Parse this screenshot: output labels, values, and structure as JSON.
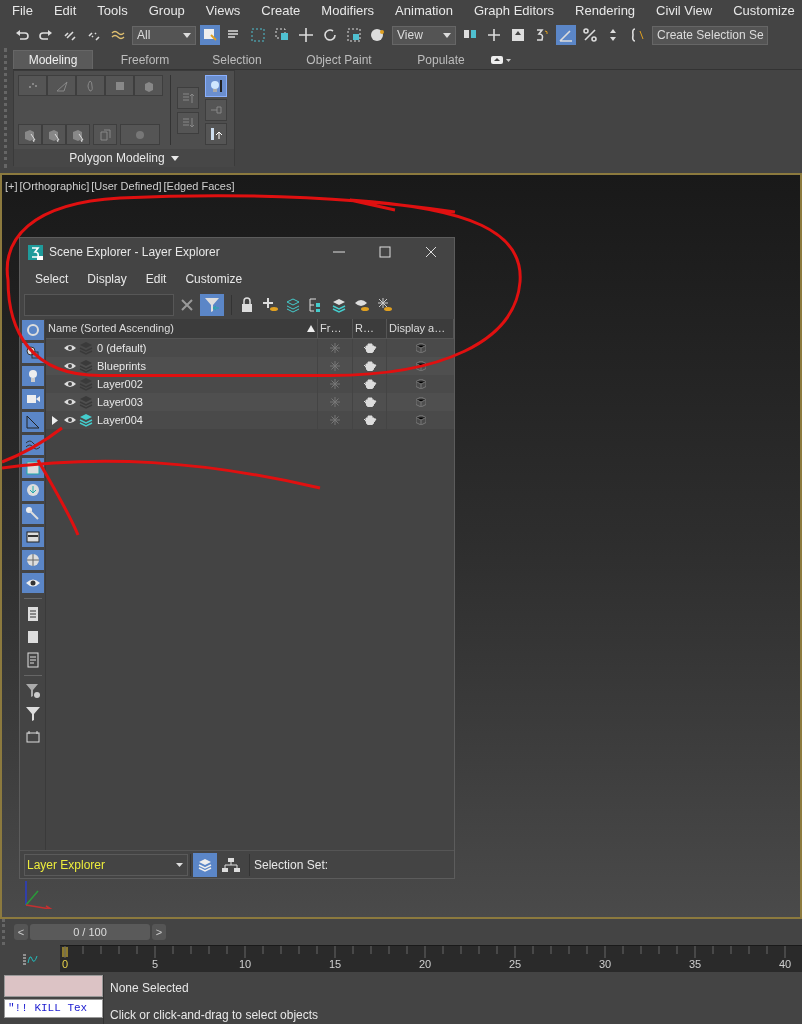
{
  "menu_bar": [
    "File",
    "Edit",
    "Tools",
    "Group",
    "Views",
    "Create",
    "Modifiers",
    "Animation",
    "Graph Editors",
    "Rendering",
    "Civil View",
    "Customize"
  ],
  "toolbar": {
    "selection_filter": "All",
    "reference_coordinate": "View",
    "selection_set": "Create Selection Se"
  },
  "ribbon": {
    "tabs": [
      {
        "label": "Modeling",
        "selected": true
      },
      {
        "label": "Freeform",
        "selected": false
      },
      {
        "label": "Selection",
        "selected": false
      },
      {
        "label": "Object Paint",
        "selected": false
      },
      {
        "label": "Populate",
        "selected": false
      }
    ],
    "panel_title": "Polygon Modeling"
  },
  "viewport": {
    "labels": [
      "[+]",
      "[Orthographic]",
      "[User Defined]",
      "[Edged Faces]"
    ]
  },
  "scene_explorer": {
    "title": "Scene Explorer - Layer Explorer",
    "menu": [
      "Select",
      "Display",
      "Edit",
      "Customize"
    ],
    "columns": [
      "Name (Sorted Ascending)",
      "Fr…",
      "R…",
      "Display a…"
    ],
    "rows": [
      {
        "name": "0 (default)",
        "current": false,
        "expandable": false
      },
      {
        "name": "Blueprints",
        "current": false,
        "expandable": false
      },
      {
        "name": "Layer002",
        "current": false,
        "expandable": false
      },
      {
        "name": "Layer003",
        "current": false,
        "expandable": false
      },
      {
        "name": "Layer004",
        "current": true,
        "expandable": true
      }
    ],
    "filter_buttons": [
      {
        "selected": true
      },
      {
        "selected": true
      },
      {
        "selected": true
      },
      {
        "selected": true
      },
      {
        "selected": true
      },
      {
        "selected": true
      },
      {
        "selected": true
      },
      {
        "selected": true
      },
      {
        "selected": true
      },
      {
        "selected": true
      },
      {
        "selected": true
      },
      {
        "selected": true
      }
    ],
    "footer": {
      "explorer": "Layer Explorer",
      "selection_set_label": "Selection Set:"
    }
  },
  "timeline": {
    "previous": "<",
    "frame": "0 / 100",
    "next": ">",
    "level": 0,
    "ticks": [
      "0",
      "5",
      "10",
      "15",
      "20",
      "25",
      "30",
      "35",
      "40"
    ]
  },
  "status_bar": {
    "script_field": "\"!! KILL Tex",
    "selection": "None Selected",
    "prompt": "Click or click-and-drag to select objects"
  }
}
